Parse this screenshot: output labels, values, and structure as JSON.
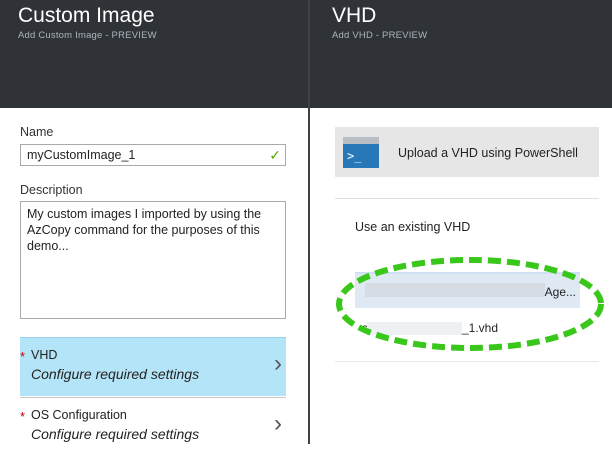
{
  "left_blade": {
    "title": "Custom Image",
    "subtitle": "Add Custom Image - PREVIEW",
    "name_label": "Name",
    "name_value": "myCustomImage_1",
    "description_label": "Description",
    "description_value": "My custom images I imported by using the AzCopy command for the purposes of this demo...",
    "settings": [
      {
        "required_mark": "*",
        "name": "VHD",
        "value": "Configure required settings"
      },
      {
        "required_mark": "*",
        "name": "OS Configuration",
        "value": "Configure required settings"
      }
    ]
  },
  "right_blade": {
    "title": "VHD",
    "subtitle": "Add VHD - PREVIEW",
    "upload_button_label": "Upload a VHD using PowerShell",
    "powershell_prompt": ">_",
    "use_existing_label": "Use an existing VHD",
    "storage_account_suffix": "Age...",
    "vhd_file_prefix": "s",
    "vhd_file_suffix": "_1.vhd"
  },
  "colors": {
    "header_bg": "#2f3338",
    "selected_setting_bg": "#b4e4f7",
    "valid_check": "#57a300",
    "highlight_outline": "#39c71b",
    "powershell_blue": "#2878b8"
  },
  "icons": {
    "valid": "checkmark-icon",
    "chevron": "chevron-right-icon",
    "powershell": "powershell-icon"
  }
}
